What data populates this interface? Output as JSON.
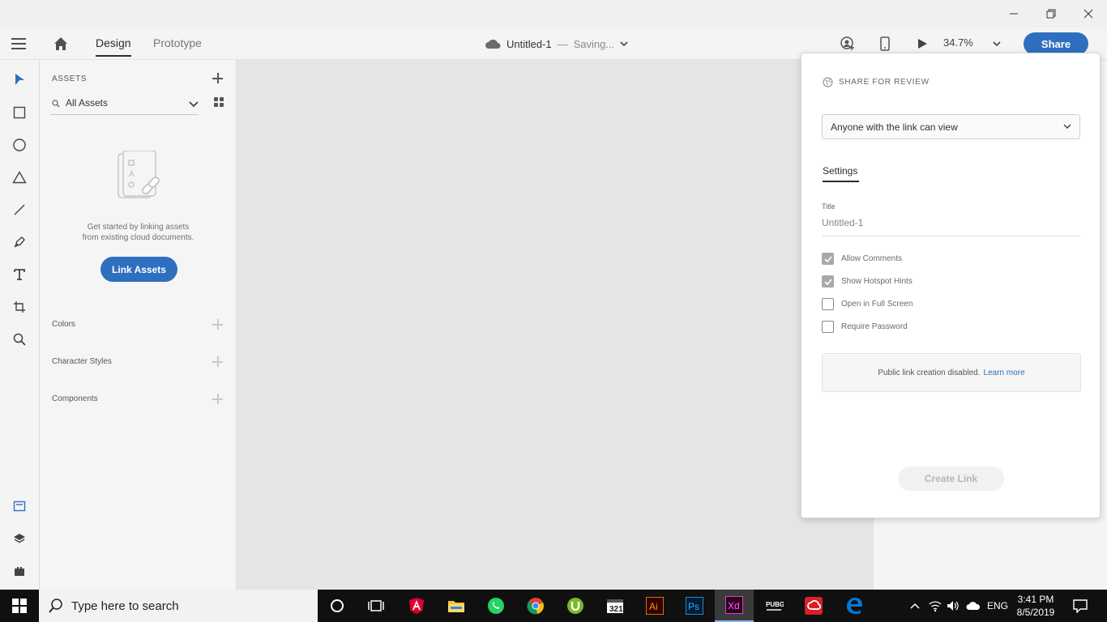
{
  "header": {
    "tabs": [
      "Design",
      "Prototype"
    ],
    "doc_title": "Untitled-1",
    "separator": "—",
    "status": "Saving...",
    "zoom": "34.7%",
    "share_label": "Share"
  },
  "assets": {
    "title": "ASSETS",
    "filter": "All Assets",
    "empty_line1": "Get started by linking assets",
    "empty_line2": "from existing cloud documents.",
    "link_button": "Link Assets",
    "sections": [
      "Colors",
      "Character Styles",
      "Components"
    ]
  },
  "share_panel": {
    "heading": "SHARE FOR REVIEW",
    "access": "Anyone with the link can view",
    "settings_tab": "Settings",
    "title_label": "Title",
    "title_value": "Untitled-1",
    "options": [
      {
        "label": "Allow Comments",
        "checked": true
      },
      {
        "label": "Show Hotspot Hints",
        "checked": true
      },
      {
        "label": "Open in Full Screen",
        "checked": false
      },
      {
        "label": "Require Password",
        "checked": false
      }
    ],
    "notice": "Public link creation disabled.",
    "notice_link": "Learn more",
    "create_button": "Create Link"
  },
  "taskbar": {
    "search_placeholder": "Type here to search",
    "language": "ENG",
    "time": "3:41 PM",
    "date": "8/5/2019",
    "apps": [
      "cortana",
      "task-view",
      "angular",
      "file-explorer",
      "whatsapp",
      "chrome",
      "utorrent",
      "media-player-classic",
      "illustrator",
      "photoshop",
      "adobe-xd",
      "pubg",
      "creative-cloud",
      "edge"
    ]
  },
  "colors": {
    "accent": "#2f6fc0",
    "illustrator": "#ff9a00",
    "photoshop": "#31a8ff",
    "xd": "#ff61f6"
  }
}
